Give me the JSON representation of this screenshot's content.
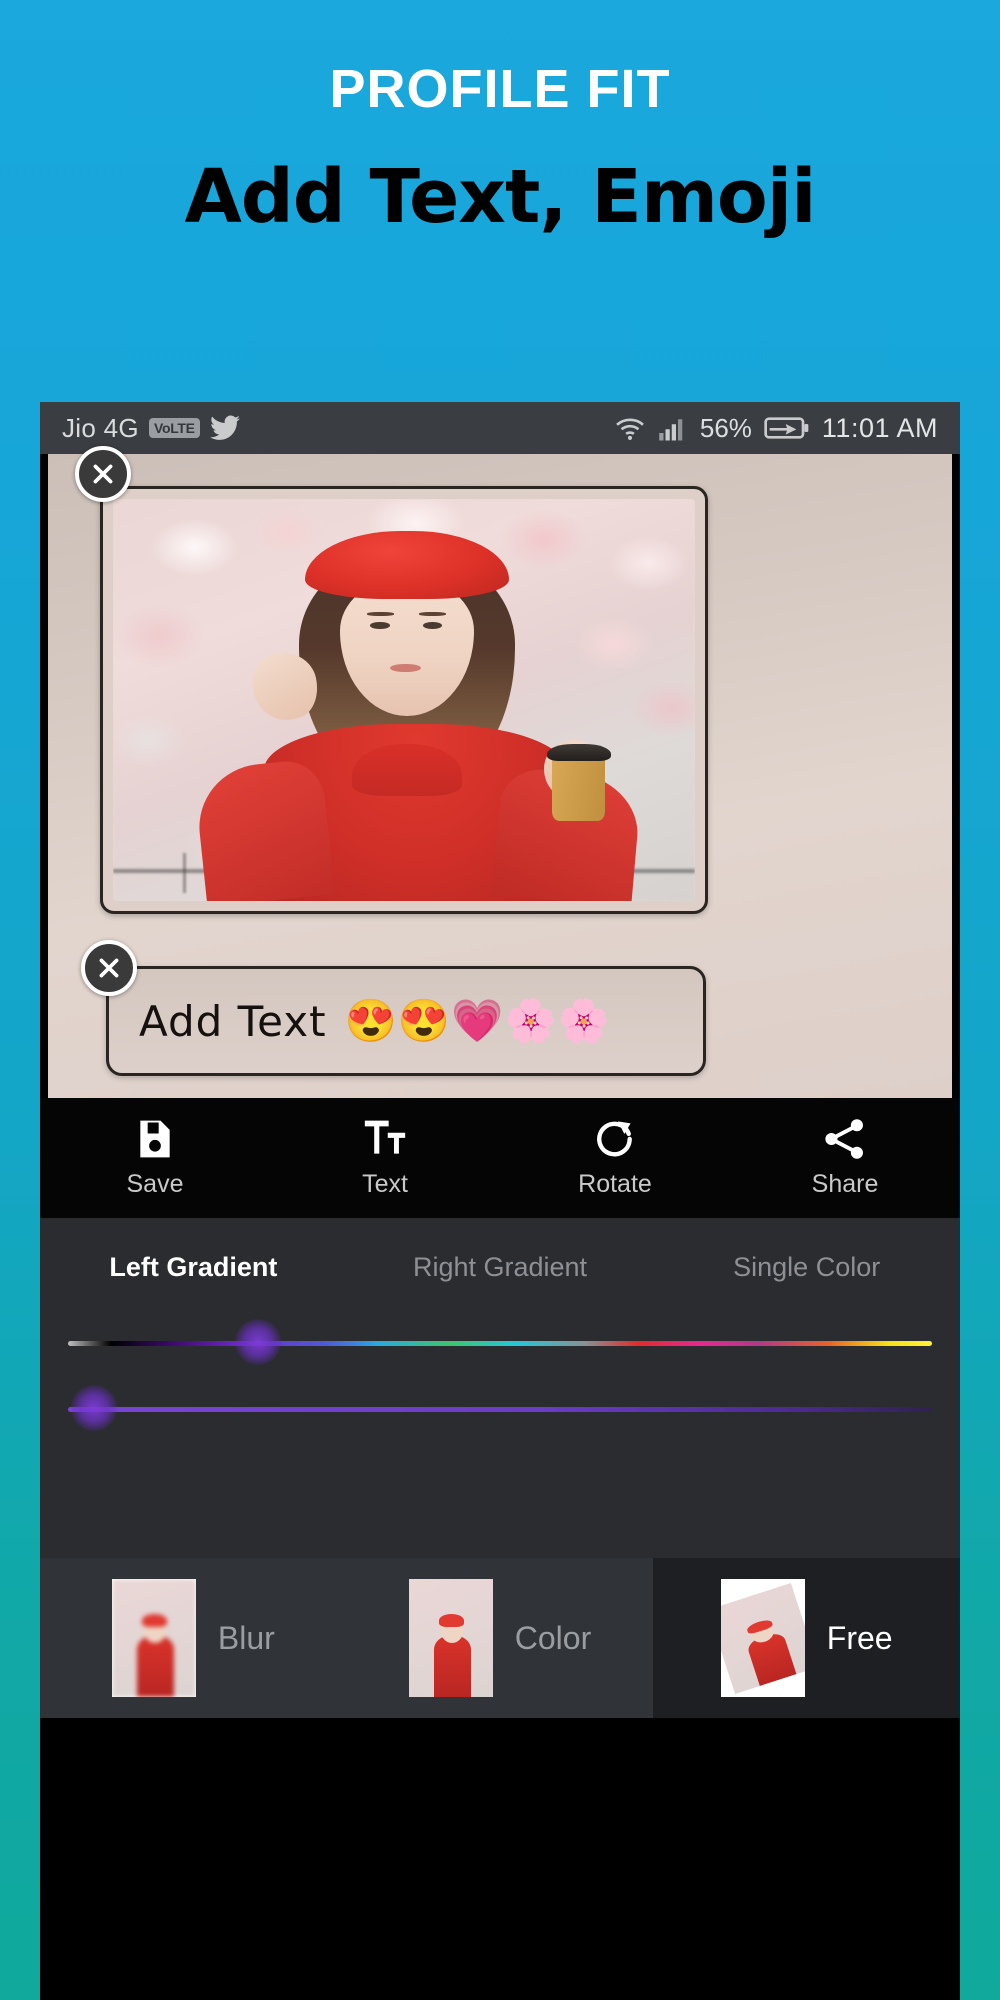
{
  "promo": {
    "title": "PROFILE FIT",
    "subtitle": "Add Text, Emoji",
    "title_color": "#ffffff",
    "subtitle_color": "#000000",
    "background_top": "#1aa8dd",
    "background_bottom": "#10a99c"
  },
  "statusbar": {
    "carrier": "Jio 4G",
    "volte_badge": "VoLTE",
    "app_icon": "twitter-icon",
    "wifi_icon": "wifi-icon",
    "signal_icon": "signal-bars-icon",
    "battery_percent": "56%",
    "battery_icon": "battery-charging-icon",
    "time": "11:01 AM",
    "background": "#3a3d41"
  },
  "canvas": {
    "background": "#ded0c9",
    "photo_close_label": "close-icon",
    "text_close_label": "close-icon"
  },
  "sticker": {
    "text": "Add Text",
    "emojis": "😍😍💗🌸🌸"
  },
  "toolbar": {
    "background": "#050505",
    "items": [
      {
        "label": "Save",
        "icon": "save-floppy-icon"
      },
      {
        "label": "Text",
        "icon": "text-tt-icon"
      },
      {
        "label": "Rotate",
        "icon": "rotate-cw-icon"
      },
      {
        "label": "Share",
        "icon": "share-nodes-icon"
      }
    ]
  },
  "gradient_panel": {
    "background": "#2a2c30",
    "tabs": [
      {
        "label": "Left Gradient",
        "active": true
      },
      {
        "label": "Right Gradient",
        "active": false
      },
      {
        "label": "Single Color",
        "active": false
      }
    ],
    "sliders": [
      {
        "name": "hue-slider",
        "value_percent": 22,
        "thumb_color": "#7d3cd7"
      },
      {
        "name": "intensity-slider",
        "value_percent": 3,
        "thumb_color": "#7d3cd7"
      }
    ]
  },
  "modes": [
    {
      "label": "Blur",
      "selected": false,
      "thumb": "blurred-photo-thumb"
    },
    {
      "label": "Color",
      "selected": false,
      "thumb": "color-photo-thumb"
    },
    {
      "label": "Free",
      "selected": true,
      "thumb": "tilted-photo-thumb"
    }
  ]
}
